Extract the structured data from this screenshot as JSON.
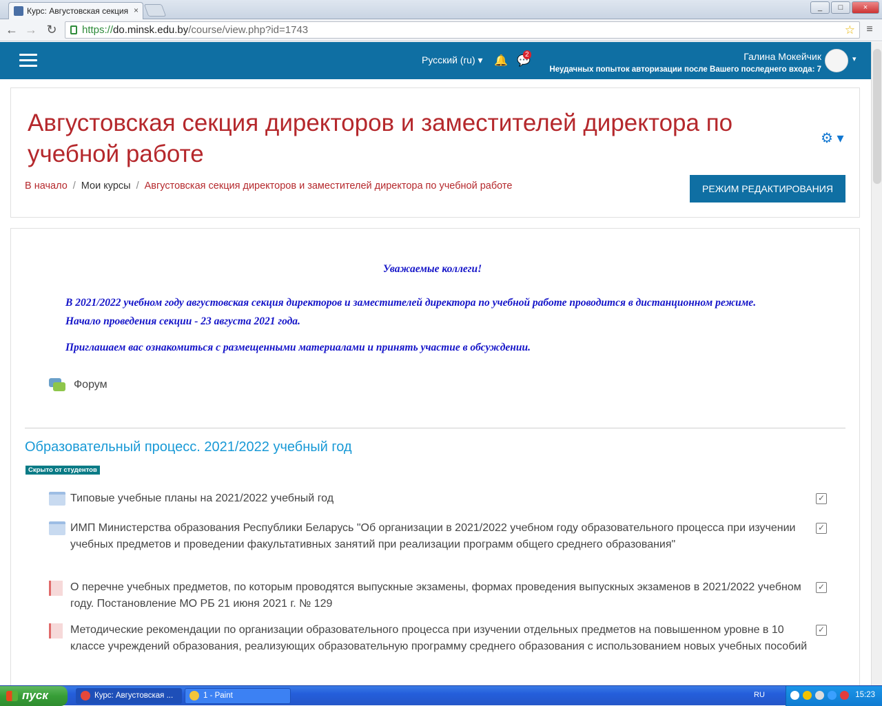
{
  "browser": {
    "tab_title": "Курс: Августовская секция",
    "tab_close": "×",
    "url_scheme": "https://",
    "url_host": "do.minsk.edu.by",
    "url_path": "/course/view.php?id=1743",
    "back": "←",
    "forward": "→",
    "reload": "↻",
    "star": "☆",
    "menu": "≡",
    "win_min": "_",
    "win_max": "□",
    "win_close": "×"
  },
  "header": {
    "language": "Русский (ru) ▾",
    "bell": "🔔",
    "messages": "💬",
    "messages_count": "2",
    "user_name": "Галина Мокейчик",
    "login_info": "Неудачных попыток авторизации после Вашего последнего входа: 7",
    "user_caret": "▾"
  },
  "course": {
    "title": "Августовская секция директоров и заместителей директора по учебной работе",
    "gear": "⚙ ▾",
    "breadcrumb": {
      "home": "В начало",
      "my_courses": "Мои курсы",
      "current": "Августовская секция директоров и заместителей директора по учебной работе",
      "sep": "/"
    },
    "edit_button": "РЕЖИМ РЕДАКТИРОВАНИЯ"
  },
  "intro": {
    "greeting": "Уважаемые коллеги!",
    "paragraph1": "В 2021/2022 учебном году августовская секция директоров и заместителей директора по учебной работе проводится в дистанционном режиме. Начало проведения секции - 23  августа 2021 года.",
    "paragraph2": "Приглашаем вас ознакомиться с размещенными материалами и принять участие в обсуждении."
  },
  "forum": {
    "label": "Форум"
  },
  "section": {
    "title": "Образовательный процесс. 2021/2022 учебный год",
    "hidden_badge": "Скрыто от студентов",
    "activities": [
      {
        "type": "folder",
        "text": "Типовые учебные планы на 2021/2022 учебный год",
        "check": "✓"
      },
      {
        "type": "folder",
        "text": "ИМП Министерства образования Республики Беларусь \"Об организации в 2021/2022 учебном году образовательного процесса при изучении учебных предметов и проведении факультативных занятий при реализации программ общего среднего образования\"",
        "check": "✓"
      },
      {
        "type": "pdf",
        "text": "О перечне учебных предметов, по которым проводятся выпускные экзамены, формах проведения выпускных экзаменов в 2021/2022 учебном году. Постановление МО РБ 21 июня 2021 г. № 129",
        "check": "✓"
      },
      {
        "type": "pdf",
        "text": "Методические рекомендации по организации образовательного процесса при изучении отдельных предметов на повышенном уровне в 10 классе учреждений образования, реализующих образовательную программу среднего образования с использованием новых учебных пособий",
        "check": "✓"
      }
    ]
  },
  "taskbar": {
    "start": "пуск",
    "task1": "Курс: Августовская ...",
    "task2": "1 - Paint",
    "lang": "RU",
    "clock": "15:23"
  }
}
